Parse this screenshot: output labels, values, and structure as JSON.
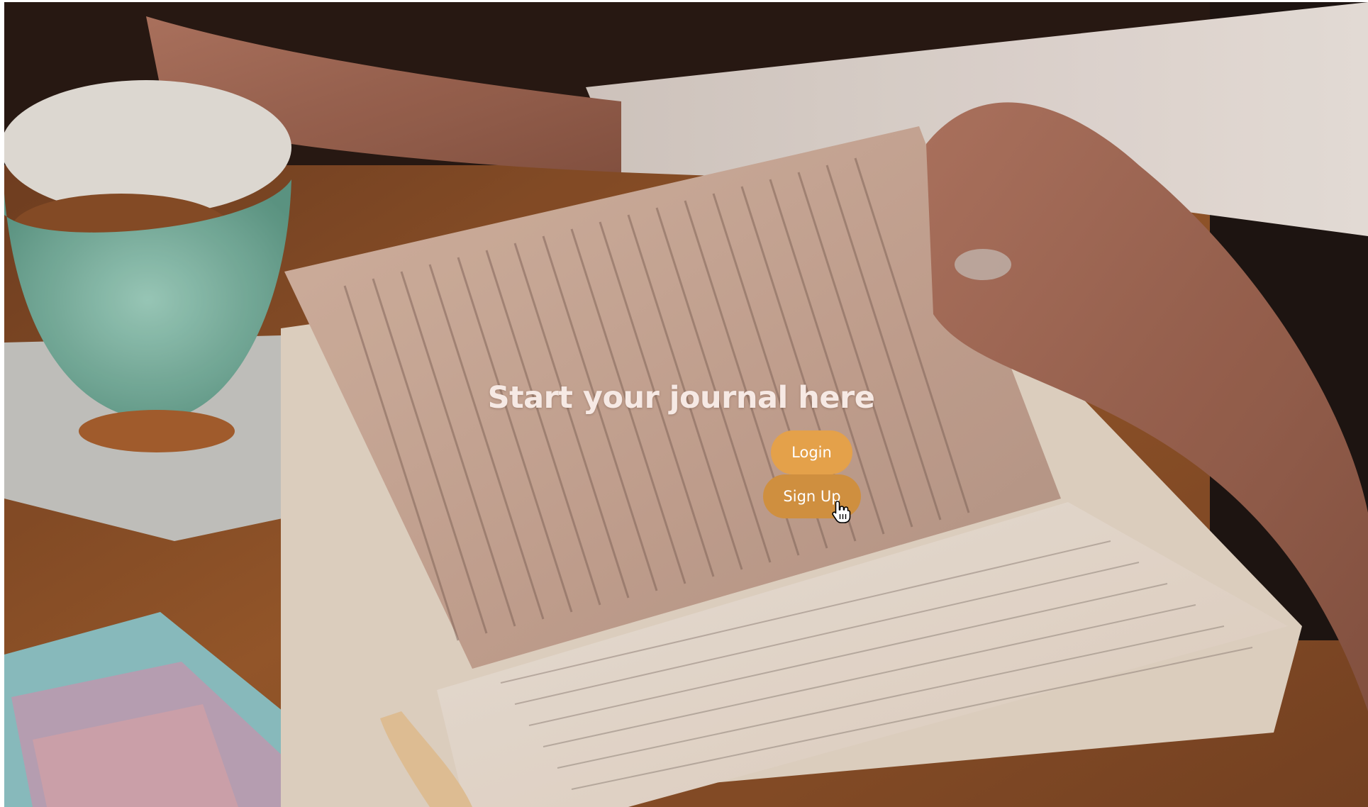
{
  "hero": {
    "title": "Start your journal here"
  },
  "actions": {
    "login_label": "Login",
    "signup_label": "Sign Up"
  },
  "colors": {
    "login_button": "#e4a14a",
    "signup_button_hover": "#cf8f3f",
    "title_text": "#f6e9e4"
  },
  "icons": {
    "cursor": "hand-pointer-icon"
  }
}
